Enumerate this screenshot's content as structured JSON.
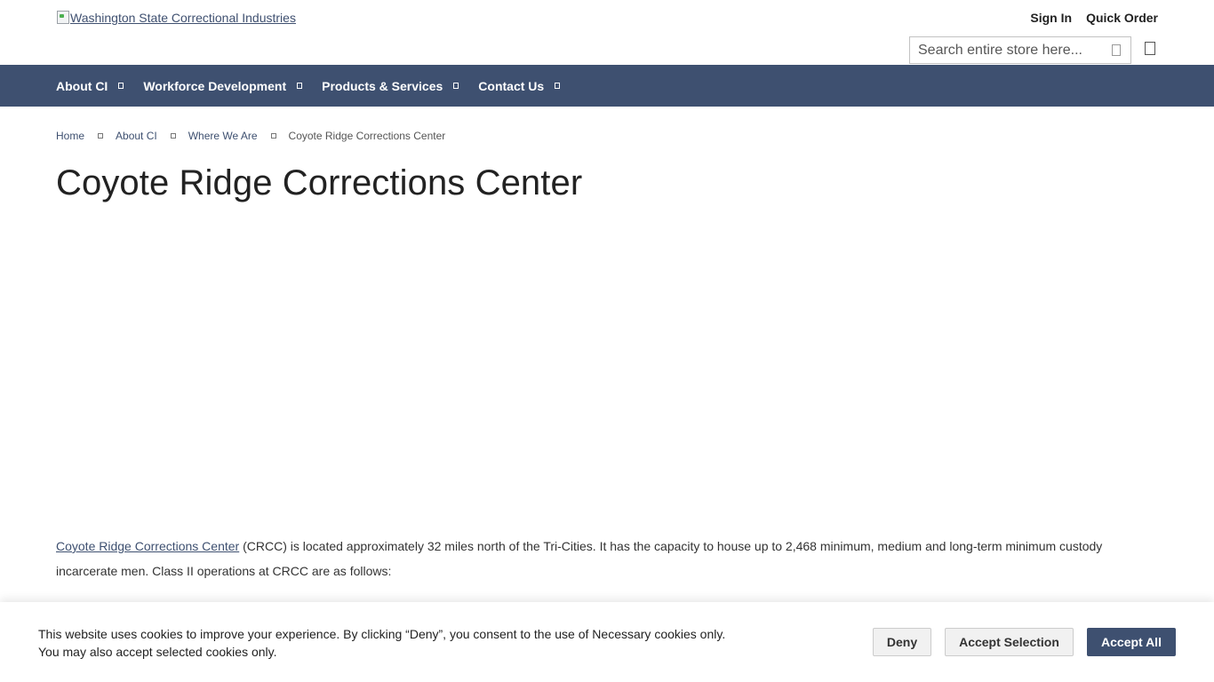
{
  "header": {
    "logo_alt": "Washington State Correctional Industries",
    "links": {
      "sign_in": "Sign In",
      "quick_order": "Quick Order"
    },
    "search": {
      "placeholder": "Search entire store here..."
    },
    "icons": {
      "search": "search-icon",
      "cart": "cart-icon"
    }
  },
  "nav": {
    "items": [
      {
        "label": "About CI"
      },
      {
        "label": "Workforce Development"
      },
      {
        "label": "Products & Services"
      },
      {
        "label": "Contact Us"
      }
    ]
  },
  "breadcrumb": [
    {
      "label": "Home"
    },
    {
      "label": "About CI"
    },
    {
      "label": "Where We Are"
    },
    {
      "label": "Coyote Ridge Corrections Center"
    }
  ],
  "main": {
    "title": "Coyote Ridge Corrections Center",
    "desc_link": "Coyote Ridge Corrections Center",
    "desc_rest": " (CRCC) is located approximately 32 miles north of the Tri-Cities. It has the capacity to house up to 2,468 minimum, medium and long-term minimum custody incarcerate men. Class II operations at CRCC are as follows:"
  },
  "cookie": {
    "text": "This website uses cookies to improve your experience. By clicking “Deny”, you consent to the use of Necessary cookies only. You may also accept selected cookies only.",
    "deny": "Deny",
    "accept_selection": "Accept Selection",
    "accept_all": "Accept All"
  },
  "colors": {
    "nav_bg": "#3e5070",
    "accent": "#3e5070"
  }
}
